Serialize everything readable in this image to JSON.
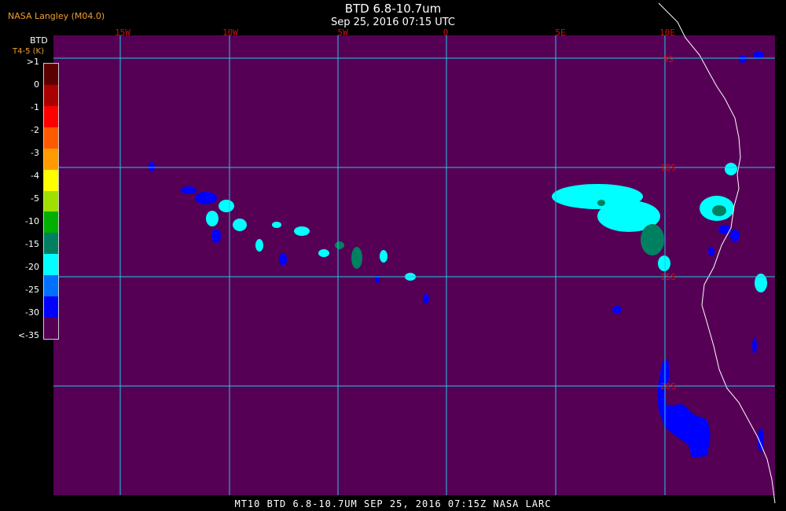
{
  "header": {
    "credit": "NASA Langley (M04.0)",
    "title": "BTD 6.8-10.7um",
    "subtitle": "Sep 25, 2016 07:15 UTC"
  },
  "legend": {
    "title": "BTD",
    "units": "T4-5 (K)",
    "entries": [
      {
        "label": ">1",
        "color": "#5a0000"
      },
      {
        "label": "0",
        "color": "#aa0000"
      },
      {
        "label": "-1",
        "color": "#ff0000"
      },
      {
        "label": "-2",
        "color": "#ff5a00"
      },
      {
        "label": "-3",
        "color": "#ff9a00"
      },
      {
        "label": "-4",
        "color": "#ffff00"
      },
      {
        "label": "-5",
        "color": "#a0e000"
      },
      {
        "label": "-10",
        "color": "#00b000"
      },
      {
        "label": "-15",
        "color": "#008060"
      },
      {
        "label": "-20",
        "color": "#00ffff"
      },
      {
        "label": "-25",
        "color": "#0070ff"
      },
      {
        "label": "-30",
        "color": "#0000ff"
      },
      {
        "label": "<-35",
        "color": "#550055"
      }
    ]
  },
  "map": {
    "background_color": "#550055",
    "grid_color": "#22c8e8",
    "lon_labels": [
      "15W",
      "10W",
      "5W",
      "0",
      "5E",
      "10E"
    ],
    "lat_labels": [
      "5S",
      "10S",
      "15S",
      "20S"
    ]
  },
  "footer": {
    "caption": "MT10  BTD 6.8-10.7UM  SEP 25, 2016 07:15Z  NASA LARC"
  }
}
